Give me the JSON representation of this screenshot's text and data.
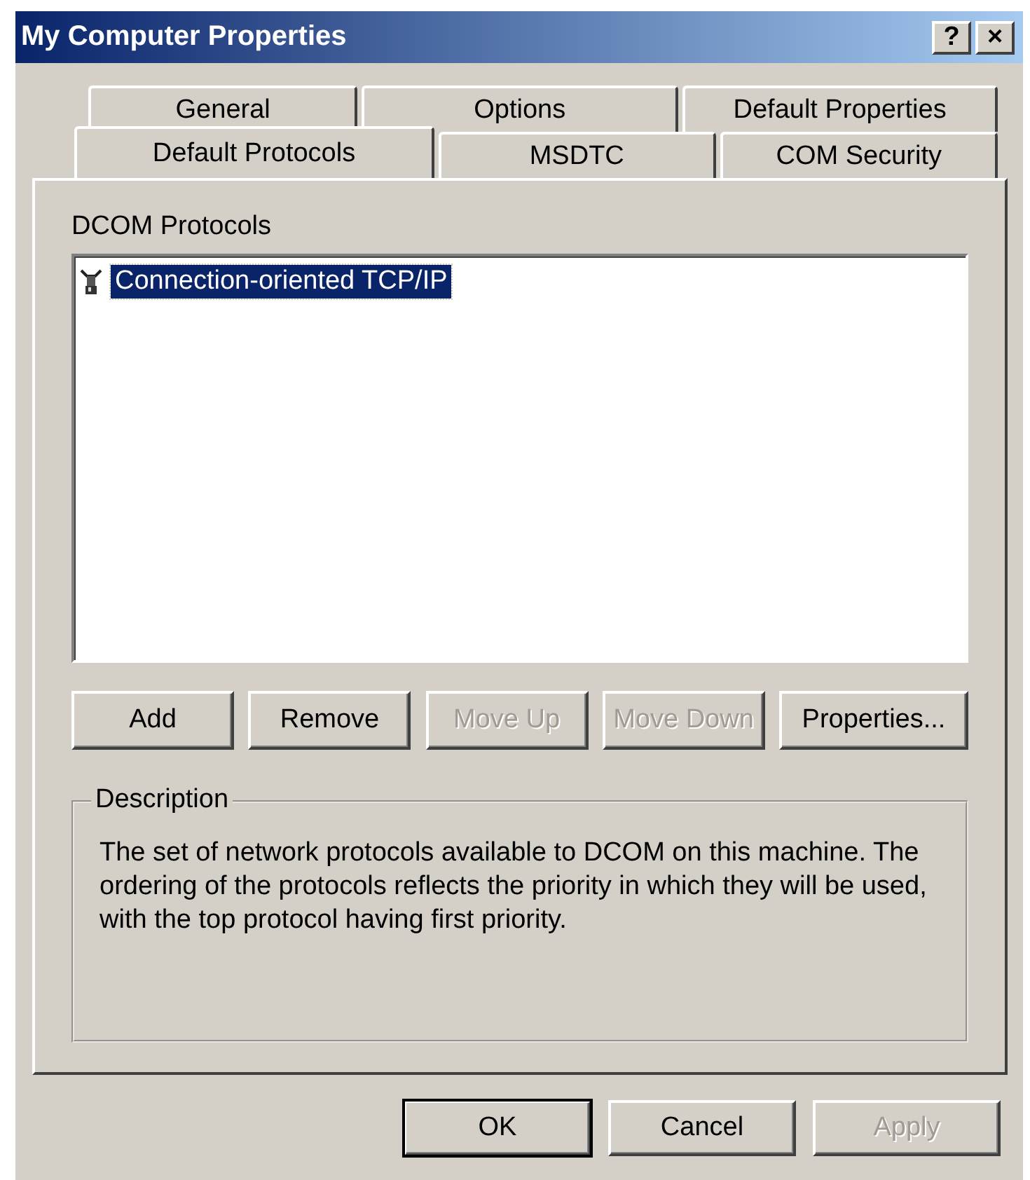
{
  "window": {
    "title": "My Computer Properties",
    "controls": [
      "?",
      "×"
    ]
  },
  "tab_rows": [
    {
      "tabs": [
        {
          "label": "General",
          "selected": false
        },
        {
          "label": "Options",
          "selected": false
        },
        {
          "label": "Default Properties",
          "selected": false
        }
      ]
    },
    {
      "tabs": [
        {
          "label": "Default Protocols",
          "selected": true
        },
        {
          "label": "MSDTC",
          "selected": false
        },
        {
          "label": "COM Security",
          "selected": false
        }
      ]
    }
  ],
  "protocols": {
    "label": "DCOM Protocols",
    "items": [
      {
        "name": "Connection-oriented TCP/IP",
        "selected": true
      }
    ]
  },
  "buttons": [
    {
      "label": "Add",
      "disabled": false
    },
    {
      "label": "Remove",
      "disabled": false
    },
    {
      "label": "Move Up",
      "disabled": true
    },
    {
      "label": "Move Down",
      "disabled": true
    },
    {
      "label": "Properties...",
      "disabled": false
    }
  ],
  "description": {
    "title": "Description",
    "text": "The set of network protocols available to DCOM on this machine. The ordering of the protocols reflects the priority in which they will be used, with the top protocol having first priority."
  },
  "dialog_buttons": [
    {
      "label": "OK",
      "default": true,
      "disabled": false
    },
    {
      "label": "Cancel",
      "default": false,
      "disabled": false
    },
    {
      "label": "Apply",
      "default": false,
      "disabled": true
    }
  ]
}
